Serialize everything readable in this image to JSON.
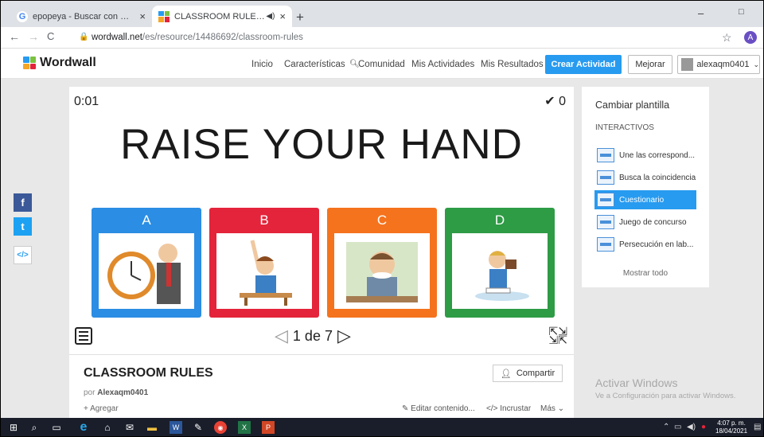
{
  "browser": {
    "tabs": [
      {
        "label": "epopeya - Buscar con Google",
        "close": "×"
      },
      {
        "label": "CLASSROOM RULES - Une la",
        "close": "×"
      }
    ],
    "new_tab": "+",
    "window_controls": [
      "–",
      "□"
    ],
    "url_host": "wordwall.net",
    "url_path": "/es/resource/14486692/classroom-rules",
    "profile_initial": "A"
  },
  "header": {
    "logo": "Wordwall",
    "nav": [
      "Inicio",
      "Características",
      "Comunidad",
      "Mis Actividades",
      "Mis Resultados"
    ],
    "crear": "Crear Actividad",
    "mejorar": "Mejorar",
    "username": "alexaqm0401"
  },
  "activity": {
    "timer": "0:01",
    "score": "0",
    "question": "RAISE YOUR HAND",
    "answers": [
      {
        "letter": "A",
        "color": "#2b8de3"
      },
      {
        "letter": "B",
        "color": "#e4243a"
      },
      {
        "letter": "C",
        "color": "#f5731d"
      },
      {
        "letter": "D",
        "color": "#2e9b45"
      }
    ],
    "page": "1 de 7"
  },
  "info": {
    "title": "CLASSROOM RULES",
    "por": "por",
    "author": "Alexaqm0401",
    "agregar": "Agregar",
    "compartir": "Compartir",
    "editar": "Editar contenido...",
    "incrustar": "Incrustar",
    "mas": "Más"
  },
  "sidebar": {
    "title": "Cambiar plantilla",
    "subtitle": "INTERACTIVOS",
    "items": [
      "Une las correspond...",
      "Busca la coincidencia",
      "Cuestionario",
      "Juego de concurso",
      "Persecución en lab..."
    ],
    "selected_index": 2,
    "more": "Mostrar todo"
  },
  "watermark": {
    "line1": "Activar Windows",
    "line2": "Ve a Configuración para activar Windows."
  },
  "taskbar": {
    "time": "4:07 p. m.",
    "date": "18/04/2021"
  }
}
